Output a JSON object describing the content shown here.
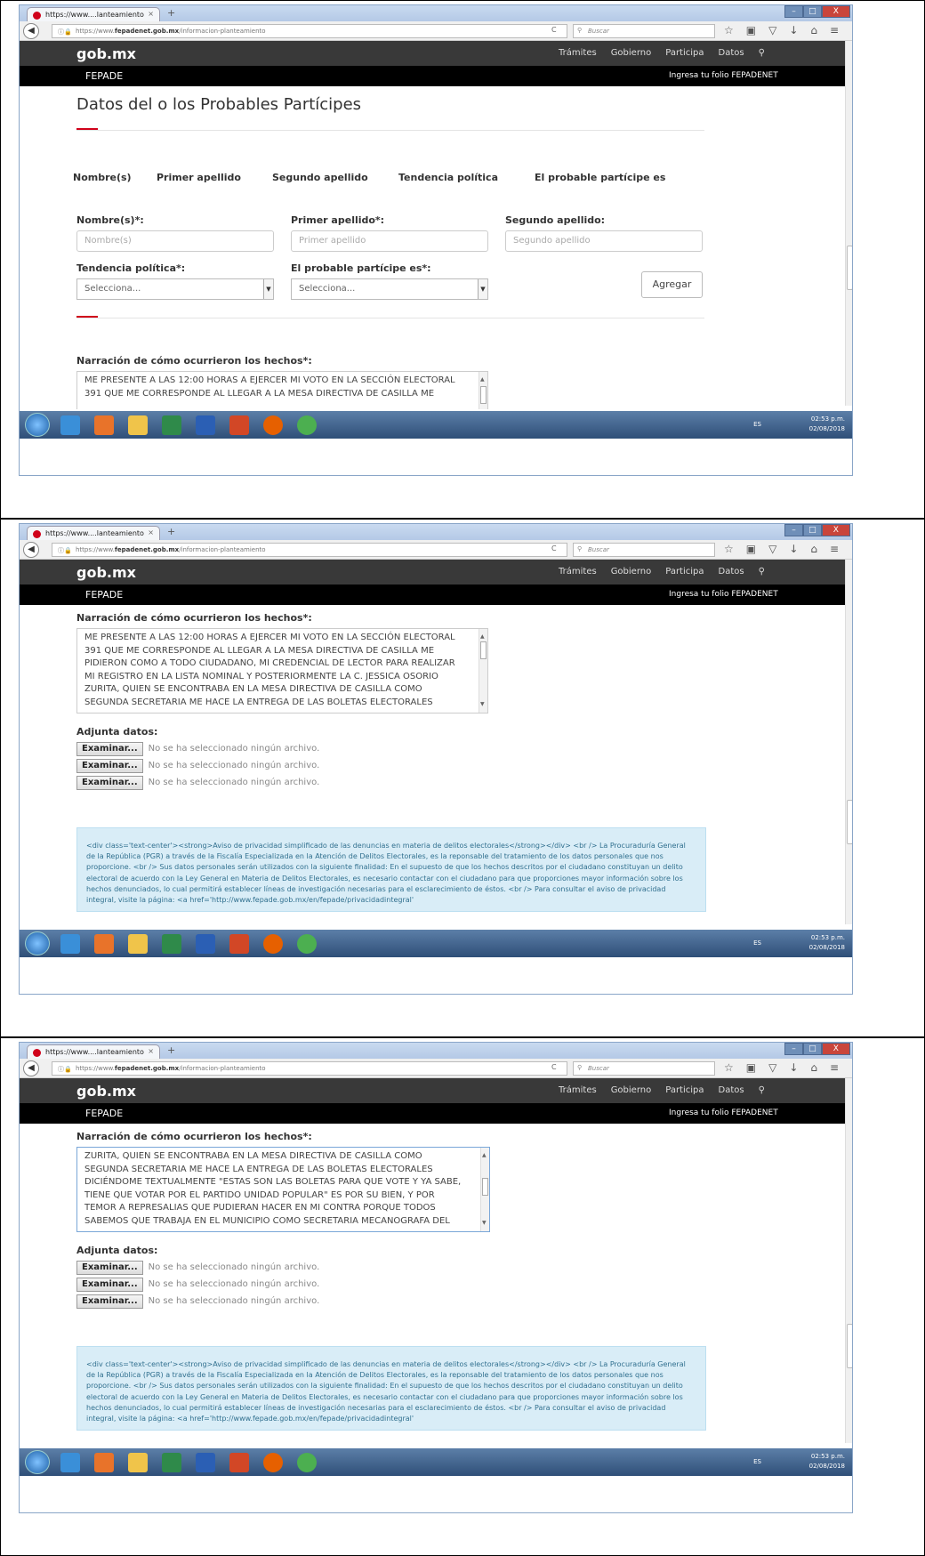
{
  "browser": {
    "tab_title": "https://www....lanteamiento",
    "tab_close": "×",
    "new_tab": "+",
    "url_prefix": "https://www.",
    "url_domain": "fepadenet.gob.mx",
    "url_path": "/informacion-planteamiento",
    "search_placeholder": "Buscar",
    "window_buttons": [
      "–",
      "□",
      "X"
    ]
  },
  "site": {
    "logo": "gob.mx",
    "nav": [
      "Trámites",
      "Gobierno",
      "Participa",
      "Datos"
    ],
    "sub_left": "FEPADE",
    "sub_right": "Ingresa tu folio FEPADENET"
  },
  "form1": {
    "title": "Datos del o los Probables Partícipes",
    "table_headers": [
      "Nombre(s)",
      "Primer apellido",
      "Segundo apellido",
      "Tendencia política",
      "El probable partícipe es"
    ],
    "nombre_label": "Nombre(s)*:",
    "nombre_placeholder": "Nombre(s)",
    "primer_label": "Primer apellido*:",
    "primer_placeholder": "Primer apellido",
    "segundo_label": "Segundo apellido:",
    "segundo_placeholder": "Segundo apellido",
    "tendencia_label": "Tendencia política*:",
    "tendencia_value": "Selecciona...",
    "participe_label": "El probable partícipe es*:",
    "participe_value": "Selecciona...",
    "add_button": "Agregar"
  },
  "narracion": {
    "label": "Narración de cómo ocurrieron los hechos*:",
    "lines_view1": [
      "ME PRESENTE A LAS 12:00 HORAS A EJERCER MI VOTO EN LA SECCIÓN ELECTORAL",
      "391 QUE ME CORRESPONDE AL LLEGAR A LA MESA DIRECTIVA DE CASILLA ME"
    ],
    "lines_view2": [
      "ME PRESENTE A LAS 12:00 HORAS A EJERCER MI VOTO EN LA SECCIÓN ELECTORAL",
      "391 QUE ME CORRESPONDE AL LLEGAR A LA MESA DIRECTIVA DE CASILLA ME",
      "PIDIERON COMO A TODO CIUDADANO, MI CREDENCIAL DE LECTOR PARA REALIZAR",
      "MI REGISTRO EN LA LISTA NOMINAL Y POSTERIORMENTE LA C. JESSICA OSORIO",
      "ZURITA, QUIEN SE ENCONTRABA EN LA MESA DIRECTIVA DE CASILLA COMO",
      "SEGUNDA SECRETARIA ME HACE LA ENTREGA DE LAS BOLETAS ELECTORALES"
    ],
    "lines_view3": [
      "ZURITA, QUIEN SE ENCONTRABA EN LA MESA DIRECTIVA DE CASILLA COMO",
      "SEGUNDA SECRETARIA ME HACE LA ENTREGA DE LAS BOLETAS ELECTORALES",
      "DICIÉNDOME TEXTUALMENTE \"ESTAS SON LAS BOLETAS PARA QUE VOTE Y YA SABE,",
      "TIENE QUE VOTAR POR EL PARTIDO UNIDAD POPULAR\" ES POR SU BIEN, Y POR",
      "TEMOR A REPRESALIAS QUE PUDIERAN HACER EN MI CONTRA PORQUE TODOS",
      "SABEMOS QUE TRABAJA EN EL MUNICIPIO COMO SECRETARIA MECANOGRAFA DEL"
    ]
  },
  "adjunta": {
    "label": "Adjunta datos:",
    "button": "Examinar...",
    "status": "No se ha seleccionado ningún archivo."
  },
  "notice": {
    "text": "<div class='text-center'><strong>Aviso de privacidad simplificado de las denuncias en materia de delitos electorales</strong></div> <br /> La Procuraduría General de la República (PGR) a través de la Fiscalía Especializada en la Atención de Delitos Electorales, es la reponsable del tratamiento de los datos personales que nos proporcione. <br /> Sus datos personales serán utilizados con la siguiente finalidad: En el supuesto de que los hechos descritos por el ciudadano constituyan un delito electoral de acuerdo con la Ley General en Materia de Delitos Electorales, es necesario contactar con el ciudadano para que proporciones mayor información sobre los hechos denunciados, lo cual permitirá establecer líneas de investigación necesarias para el esclarecimiento de éstos. <br /> Para consultar el aviso de privacidad integral, visite la página: <a href='http://www.fepade.gob.mx/en/fepade/privacidadintegral'"
  },
  "taskbar": {
    "lang": "ES",
    "time": "02:53 p.m.",
    "date": "02/08/2018"
  },
  "colors": {
    "accent": "#d0021b",
    "header": "#393939",
    "notice_bg": "#d9edf7"
  }
}
